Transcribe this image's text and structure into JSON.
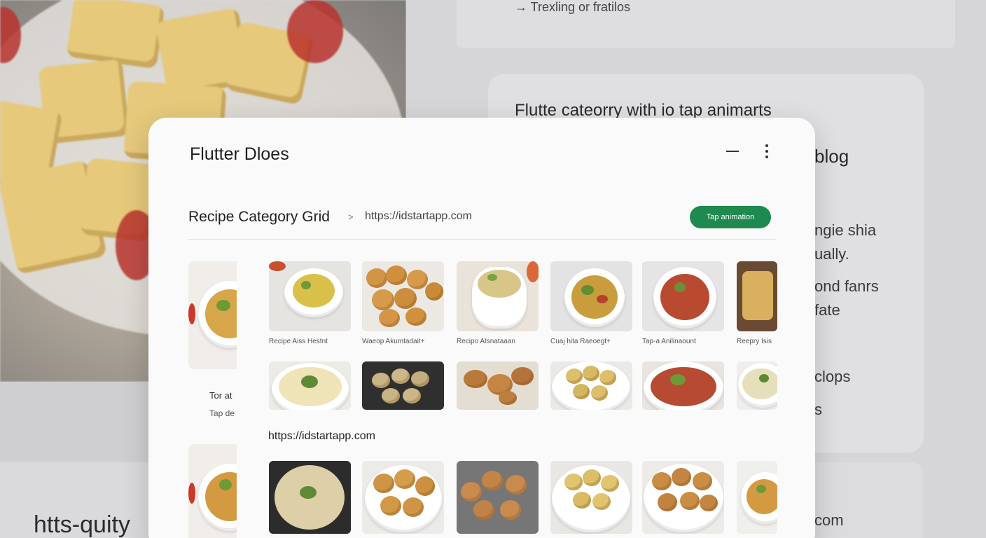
{
  "background": {
    "top_link": "→ Trexling or fratilos",
    "heading": "Flutte cateorry with io tap animarts",
    "word_blog": "blog",
    "frag_1": "ngie shia",
    "frag_2": "ually.",
    "frag_3": "ond fanrs",
    "frag_4": "fate",
    "frag_5": "clops",
    "frag_6": "s",
    "frag_com": "com",
    "bottom_left": "htts-quity"
  },
  "dialog": {
    "title": "Flutter Dloes",
    "header": {
      "title": "Recipe Category Grid",
      "separator": ">",
      "url": "https://idstartapp.com",
      "button_label": "Tap animation"
    },
    "side": {
      "line1": "Tor at",
      "line2": "Tap de"
    },
    "row1_captions": [
      "Recipe Aiss Hestnt",
      "Waeop Akumtadait+",
      "Recipo Atsnataaan",
      "Cuaj hita Raeoegt+",
      "Tap-a Anilinaount",
      "Reepry Isis"
    ],
    "grid_url": "https://idstartapp.com"
  },
  "colors": {
    "accent_button": "#1f8a4f",
    "dialog_bg": "#fafafa"
  },
  "icons": [
    "minimize-icon",
    "more-vert-icon"
  ]
}
